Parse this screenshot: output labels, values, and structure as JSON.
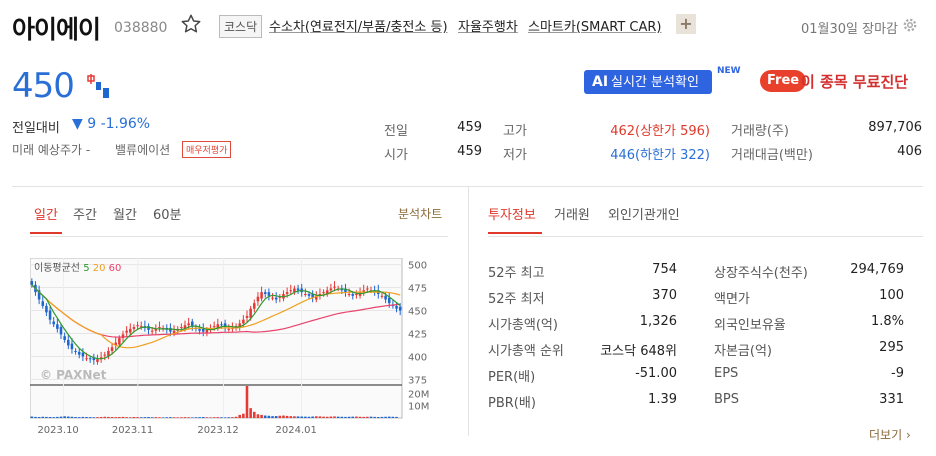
{
  "header": {
    "name": "아이에이",
    "code": "038880",
    "market": "코스닥",
    "themes": [
      "수소차(연료전지/부품/충전소 등)",
      "자율주행차",
      "스마트카(SMART CAR)"
    ],
    "plus": "+",
    "status": "01월30일 장마감"
  },
  "price": {
    "current": "450",
    "change_label": "전일대비",
    "change": "▼ 9 -1.96%",
    "future_label": "미래 예상주가",
    "future_value": "-",
    "valuation_label": "밸류에이션",
    "valuation_badge": "매우저평가"
  },
  "promo": {
    "ai_prefix": "AI",
    "ai_text": "실시간 분석확인",
    "new": "NEW",
    "free": "Free",
    "free_text": "이 종목 무료진단"
  },
  "quote": [
    {
      "label": "전일",
      "value": "459"
    },
    {
      "label": "시가",
      "value": "459"
    },
    {
      "label": "고가",
      "value": "462(상한가 596)"
    },
    {
      "label": "저가",
      "value": "446(하한가 322)"
    },
    {
      "label": "거래량(주)",
      "value": "897,706"
    },
    {
      "label": "거래대금(백만)",
      "value": "406"
    }
  ],
  "chart_tabs": [
    "일간",
    "주간",
    "월간",
    "60분"
  ],
  "chart_link": "분석차트",
  "info_tabs": [
    "투자정보",
    "거래원",
    "외인기관개인"
  ],
  "info": [
    {
      "label": "52주 최고",
      "value": "754"
    },
    {
      "label": "52주 최저",
      "value": "370"
    },
    {
      "label": "시가총액(억)",
      "value": "1,326"
    },
    {
      "label": "시가총액 순위",
      "value": "코스닥 648위"
    },
    {
      "label": "PER(배)",
      "value": "-51.00"
    },
    {
      "label": "PBR(배)",
      "value": "1.39"
    },
    {
      "label": "상장주식수(천주)",
      "value": "294,769"
    },
    {
      "label": "액면가",
      "value": "100"
    },
    {
      "label": "외국인보유율",
      "value": "1.8%"
    },
    {
      "label": "자본금(억)",
      "value": "295"
    },
    {
      "label": "EPS",
      "value": "-9"
    },
    {
      "label": "BPS",
      "value": "331"
    }
  ],
  "more": "더보기",
  "chart_data": {
    "type": "candlestick",
    "legend": {
      "label": "이동평균선",
      "ma": [
        "5",
        "20",
        "60"
      ]
    },
    "watermark": "© PAXNet",
    "y_ticks": [
      "500",
      "475",
      "450",
      "425",
      "400",
      "375"
    ],
    "ylim": [
      370,
      505
    ],
    "volume_ticks": [
      "20M",
      "10M"
    ],
    "x_ticks": [
      "2023.10",
      "2023.11",
      "2023.12",
      "2024.01"
    ],
    "colors": {
      "up": "#e53935",
      "down": "#1e66d0",
      "ma5": "#2e9a2e",
      "ma20": "#f0a020",
      "ma60": "#e8436b"
    },
    "closes": [
      478,
      470,
      462,
      455,
      448,
      440,
      435,
      430,
      424,
      418,
      412,
      408,
      405,
      402,
      400,
      398,
      397,
      396,
      397,
      399,
      402,
      406,
      410,
      415,
      420,
      424,
      428,
      430,
      432,
      434,
      433,
      431,
      429,
      428,
      430,
      432,
      431,
      429,
      427,
      428,
      430,
      432,
      434,
      436,
      433,
      430,
      428,
      427,
      429,
      431,
      433,
      435,
      434,
      432,
      430,
      431,
      433,
      436,
      440,
      444,
      452,
      458,
      465,
      470,
      468,
      466,
      464,
      462,
      465,
      468,
      470,
      472,
      474,
      472,
      470,
      468,
      466,
      464,
      466,
      468,
      470,
      472,
      474,
      476,
      474,
      472,
      470,
      468,
      466,
      468,
      470,
      472,
      474,
      472,
      470,
      468,
      466,
      462,
      458,
      455,
      452,
      450
    ],
    "volumes": [
      1.2,
      0.9,
      0.8,
      1.0,
      0.9,
      0.8,
      0.7,
      0.9,
      1.1,
      1.4,
      1.2,
      1.0,
      0.8,
      0.7,
      0.9,
      0.8,
      0.7,
      0.6,
      0.7,
      0.8,
      1.0,
      0.9,
      0.8,
      0.7,
      0.8,
      0.9,
      0.7,
      0.6,
      0.8,
      0.7,
      0.6,
      0.7,
      0.8,
      0.6,
      0.7,
      0.6,
      0.5,
      0.6,
      0.7,
      0.6,
      0.5,
      0.6,
      0.7,
      0.6,
      0.5,
      0.6,
      0.7,
      0.8,
      0.6,
      0.5,
      0.6,
      0.7,
      0.6,
      0.5,
      0.6,
      0.7,
      1.0,
      2.5,
      3.5,
      26,
      8,
      5,
      3,
      2.5,
      2,
      1.8,
      1.5,
      1.6,
      1.8,
      2.0,
      1.7,
      1.5,
      1.4,
      1.3,
      1.2,
      1.1,
      1.0,
      1.2,
      1.4,
      1.3,
      1.1,
      1.0,
      1.2,
      1.3,
      1.1,
      1.0,
      0.9,
      1.0,
      1.1,
      1.2,
      1.0,
      0.9,
      1.0,
      1.1,
      0.9,
      0.8,
      0.9,
      1.0,
      1.1,
      1.0,
      0.9
    ]
  }
}
